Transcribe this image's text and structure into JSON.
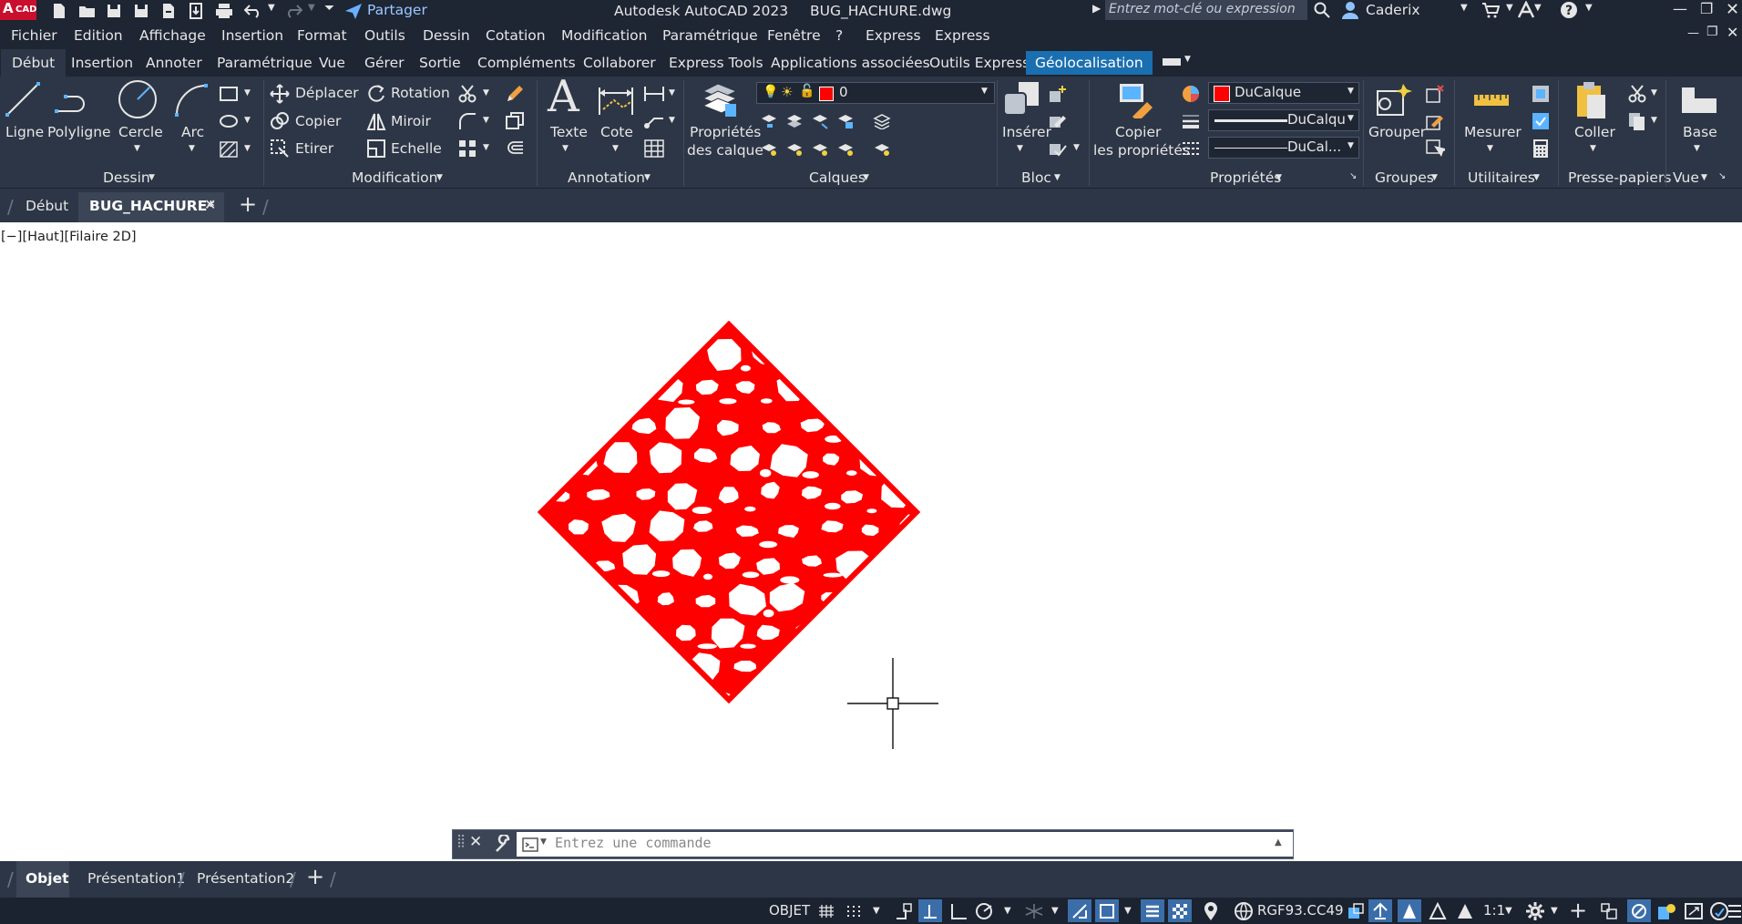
{
  "app": {
    "title": "Autodesk AutoCAD 2023",
    "file": "BUG_HACHURE.dwg",
    "logo": "CAD",
    "share": "Partager",
    "search_placeholder": "Entrez mot-clé ou expression",
    "user": "Caderix",
    "accent": "#1a6fb0",
    "logo_color": "#c8102e"
  },
  "menu": [
    "Fichier",
    "Edition",
    "Affichage",
    "Insertion",
    "Format",
    "Outils",
    "Dessin",
    "Cotation",
    "Modification",
    "Paramétrique",
    "Fenêtre",
    "?",
    "Express",
    "Express"
  ],
  "ribbon_tabs": [
    "Début",
    "Insertion",
    "Annoter",
    "Paramétrique",
    "Vue",
    "Gérer",
    "Sortie",
    "Compléments",
    "Collaborer",
    "Express Tools",
    "Applications associées",
    "Outils Express",
    "Géolocalisation"
  ],
  "ribbon": {
    "dessin": {
      "ligne": "Ligne",
      "polyligne": "Polyligne",
      "cercle": "Cercle",
      "arc": "Arc",
      "panel": "Dessin"
    },
    "modification": {
      "deplacer": "Déplacer",
      "rotation": "Rotation",
      "copier": "Copier",
      "miroir": "Miroir",
      "etirer": "Etirer",
      "echelle": "Echelle",
      "panel": "Modification"
    },
    "annotation": {
      "texte": "Texte",
      "cote": "Cote",
      "panel": "Annotation"
    },
    "calques": {
      "proprietes_1": "Propriétés",
      "proprietes_2": "des calque",
      "layer_value": "0",
      "panel": "Calques"
    },
    "bloc": {
      "inserer": "Insérer",
      "panel": "Bloc"
    },
    "proprietes": {
      "copier_1": "Copier",
      "copier_2": "les propriétés",
      "color_value": "DuCalque",
      "linetype_value": "DuCalqu",
      "lineweight_value": "DuCal...",
      "panel": "Propriétés"
    },
    "groupes": {
      "grouper": "Grouper",
      "panel": "Groupes"
    },
    "utilitaires": {
      "mesurer": "Mesurer",
      "panel": "Utilitaires"
    },
    "presse_papiers": {
      "coller": "Coller",
      "panel": "Presse-papiers"
    },
    "vue": {
      "base": "Base",
      "panel": "Vue"
    }
  },
  "doc_tabs": [
    "Début",
    "BUG_HACHURE*"
  ],
  "viewport_label": "[−][Haut][Filaire 2D]",
  "command_placeholder": "Entrez une commande",
  "layout_tabs": [
    "Objet",
    "Présentation1",
    "Présentation2"
  ],
  "status": {
    "model": "OBJET",
    "coords": "RGF93.CC49",
    "scale": "1:1"
  },
  "hatch_color": "#ff0000"
}
